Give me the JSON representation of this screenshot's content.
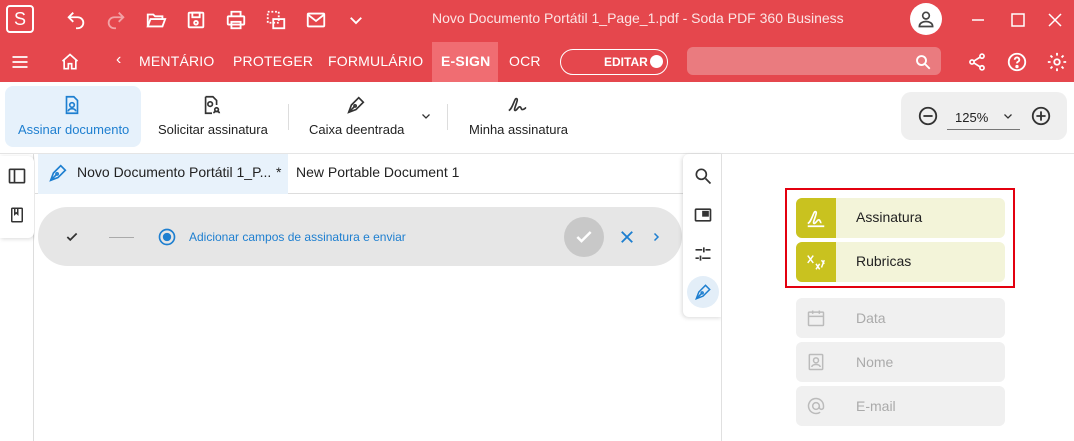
{
  "titlebar": {
    "title": "Novo Documento Portátil 1_Page_1.pdf   -   Soda PDF 360 Business",
    "app_logo": "S"
  },
  "menubar": {
    "items": [
      {
        "label": "‹"
      },
      {
        "label": "MENTÁRIO"
      },
      {
        "label": "PROTEGER"
      },
      {
        "label": "FORMULÁRIO"
      },
      {
        "label": "E-SIGN"
      },
      {
        "label": "OCR"
      }
    ],
    "edit_toggle_label": "EDITAR",
    "search_placeholder": ""
  },
  "toolbar": {
    "tools": [
      {
        "label": "Assinar documento"
      },
      {
        "label": "Solicitar assinatura"
      },
      {
        "label": "Caixa deentrada"
      },
      {
        "label": "Minha assinatura"
      }
    ],
    "zoom_value": "125%"
  },
  "document": {
    "tabs": [
      {
        "label": "Novo Documento Portátil 1_P..."
      },
      {
        "label": "*"
      },
      {
        "label": "New Portable Document 1"
      }
    ],
    "step_text": "Adicionar campos de assinatura e enviar"
  },
  "fields_panel": {
    "fields": [
      {
        "label": "Assinatura",
        "icon": "signature-icon"
      },
      {
        "label": "Rubricas",
        "icon": "initials-icon"
      },
      {
        "label": "Data",
        "icon": "calendar-icon"
      },
      {
        "label": "Nome",
        "icon": "name-card-icon"
      },
      {
        "label": "E-mail",
        "icon": "at-icon"
      }
    ]
  },
  "colors": {
    "brand_red": "#e5474d",
    "active_tab": "#f06d72",
    "accent_blue": "#1e7fd0",
    "field_green": "#c9c21f",
    "highlight_box": "#e3000f"
  }
}
